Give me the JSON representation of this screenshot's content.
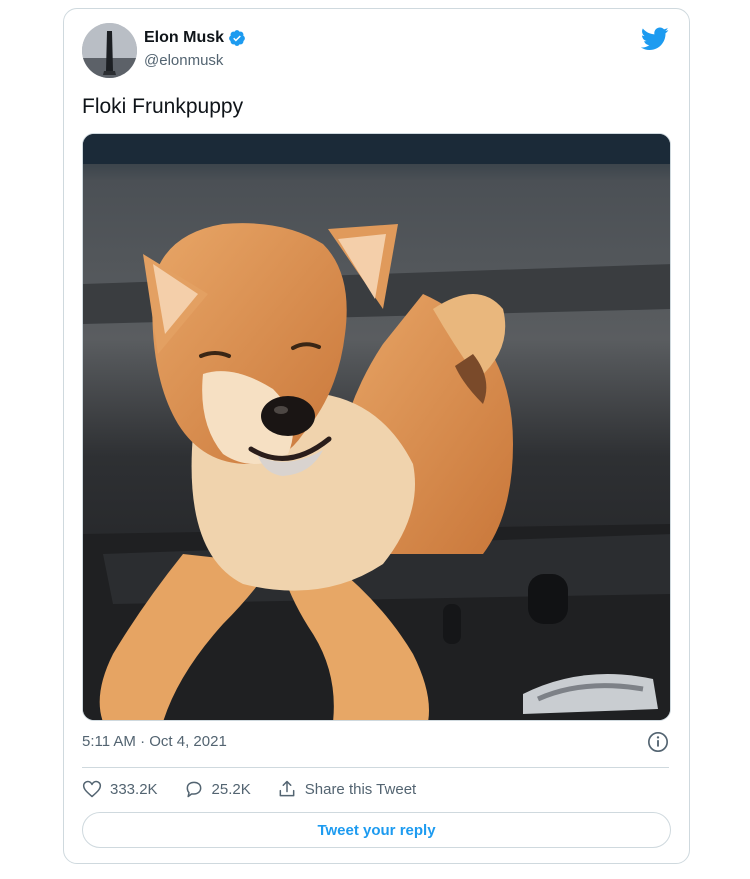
{
  "tweet": {
    "author_name": "Elon Musk",
    "author_handle": "@elonmusk",
    "text": "Floki Frunkpuppy",
    "timestamp": "5:11 AM · Oct 4, 2021",
    "likes": "333.2K",
    "replies": "25.2K",
    "share_label": "Share this Tweet",
    "reply_button_label": "Tweet your reply"
  },
  "icons": {
    "verified": "verified-badge-icon",
    "brand": "twitter-bird-icon",
    "info": "info-icon",
    "like": "heart-icon",
    "reply": "speech-bubble-icon",
    "share": "share-icon"
  },
  "colors": {
    "accent": "#1d9bf0",
    "secondary_text": "#536471",
    "border": "#cfd9de"
  }
}
